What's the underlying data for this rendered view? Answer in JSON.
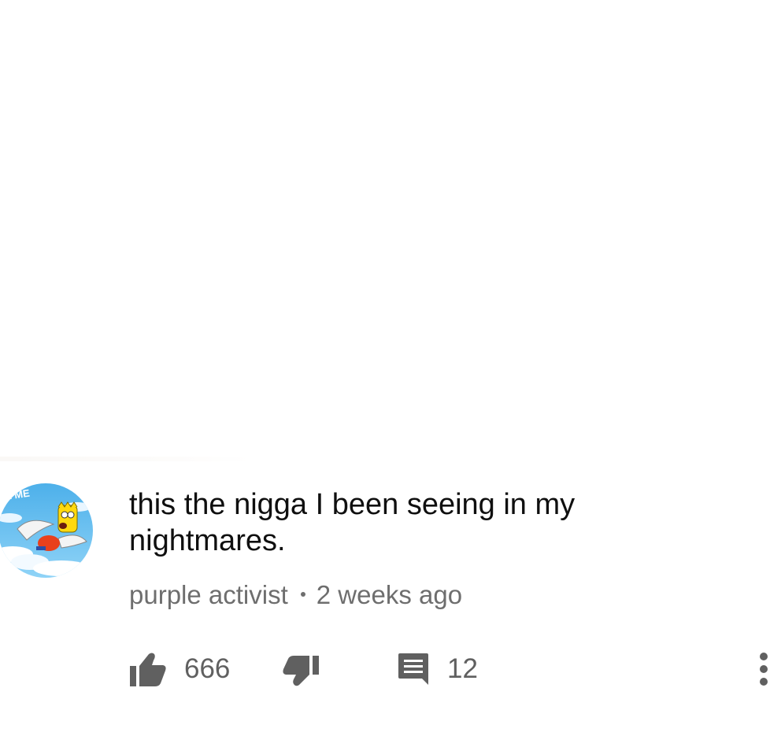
{
  "comment": {
    "text": "this the nigga I been seeing in my nightmares.",
    "author": "purple activist",
    "time_ago": "2 weeks ago",
    "avatar": {
      "banner_text": "E ME",
      "icon": "cartoon-angel-avatar"
    }
  },
  "actions": {
    "like_count": "666",
    "reply_count": "12",
    "like_icon": "thumbs-up-icon",
    "dislike_icon": "thumbs-down-icon",
    "reply_icon": "comment-icon",
    "more_icon": "more-vertical-icon"
  },
  "colors": {
    "text_primary": "#0f0f0f",
    "text_secondary": "#6e6e6e",
    "icon": "#606060"
  }
}
